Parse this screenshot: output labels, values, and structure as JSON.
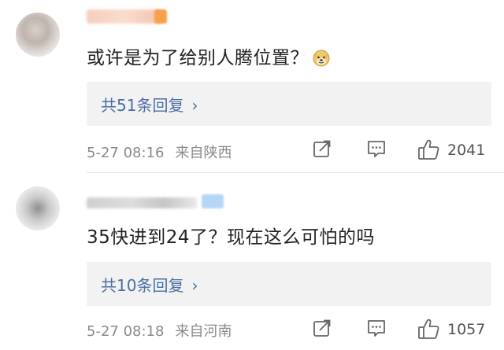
{
  "comments": [
    {
      "text": "或许是为了给别人腾位置？",
      "emoji": "doge-icon",
      "reply_text": "共51条回复",
      "chevron": "›",
      "time": "5-27 08:16",
      "location": "来自陕西",
      "likes": "2041"
    },
    {
      "text": "35快进到24了？现在这么可怕的吗",
      "reply_text": "共10条回复",
      "chevron": "›",
      "time": "5-27 08:18",
      "location": "来自河南",
      "likes": "1057"
    }
  ],
  "colors": {
    "link": "#4a6fa5",
    "meta": "#8a8a8a",
    "reply_bg": "#f2f2f2"
  }
}
